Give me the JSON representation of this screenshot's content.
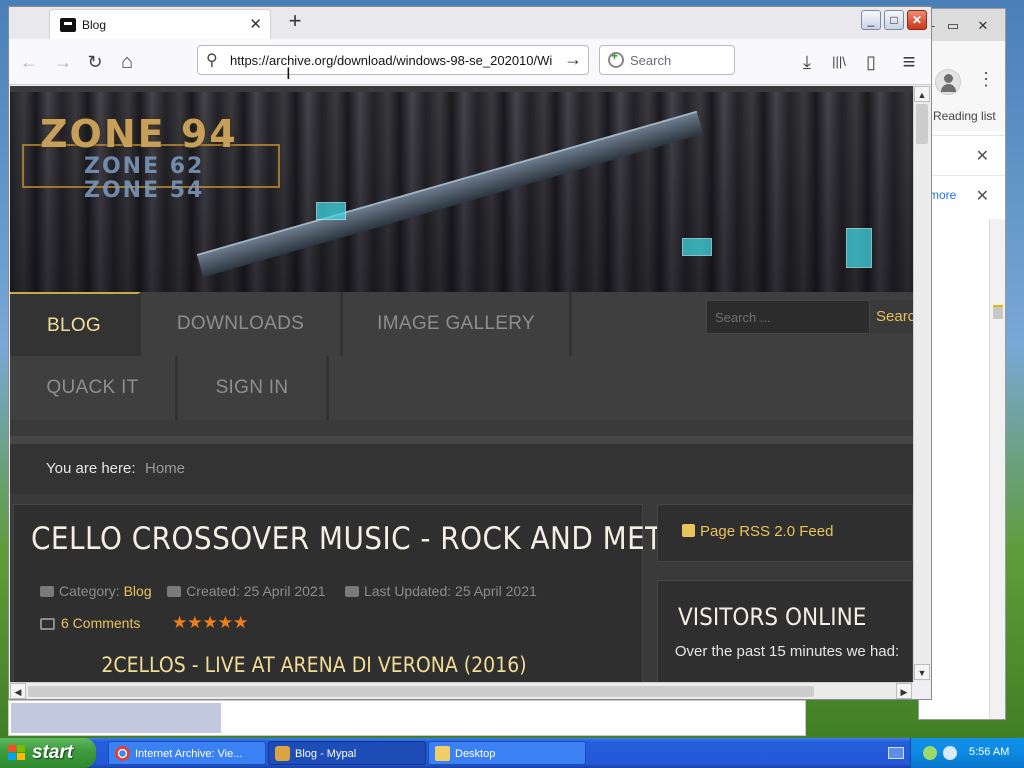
{
  "background_window": {
    "reading_list_label": "Reading list",
    "more_link": "more",
    "minimize": "–",
    "restore": "▭",
    "close": "✕",
    "kebab": "⋮",
    "item_close": "✕"
  },
  "browser": {
    "tab": {
      "title": "Blog",
      "close": "✕"
    },
    "new_tab": "+",
    "window_controls": {
      "minimize": "_",
      "maximize": "□",
      "close": "✕"
    },
    "nav": {
      "back": "←",
      "forward": "→",
      "reload": "↻",
      "home": "⌂"
    },
    "url": "https://archive.org/download/windows-98-se_202010/Wi",
    "url_go": "→",
    "search_placeholder": "Search",
    "toolbar_icons": {
      "downloads": "⤓",
      "library": "|||\\",
      "sidebar": "▯",
      "menu": "≡"
    }
  },
  "site": {
    "logo": {
      "main": "ZONE 94",
      "sub1": "ZONE 62",
      "sub2": "ZONE 54"
    },
    "menu_row1": [
      "BLOG",
      "DOWNLOADS",
      "IMAGE GALLERY"
    ],
    "menu_row2": [
      "QUACK IT",
      "SIGN IN"
    ],
    "search_placeholder": "Search ...",
    "search_button": "Search",
    "breadcrumb": {
      "label": "You are here:",
      "home": "Home"
    },
    "article": {
      "title": "CELLO CROSSOVER MUSIC - ROCK AND METAL",
      "category_label": "Category:",
      "category": "Blog",
      "created": "Created: 25 April 2021",
      "updated": "Last Updated: 25 April 2021",
      "comments": "6 Comments",
      "rating_stars": 5,
      "stars": "★★★★★",
      "video_title": "2CELLOS - LIVE AT ARENA DI VERONA (2016)"
    },
    "rss": "Page RSS 2.0 Feed",
    "visitors": {
      "title": "VISITORS ONLINE",
      "text": "Over the past 15 minutes we had:"
    }
  },
  "taskbar": {
    "start": "start",
    "tasks": [
      "Internet Archive: Vie...",
      "Blog - Mypal",
      "Desktop"
    ],
    "clock": "5:56 AM"
  },
  "colors": {
    "accent_gold": "#e9c45c",
    "menu_active": "#f2df9a",
    "stars": "#ee7f1b",
    "xp_taskbar": "#245edb"
  }
}
